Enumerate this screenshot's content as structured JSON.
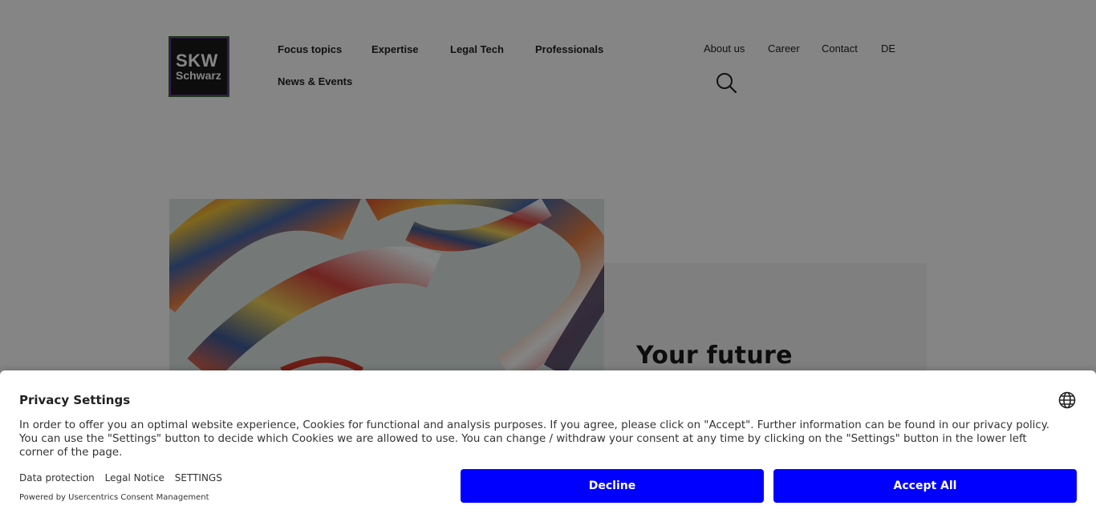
{
  "header": {
    "logo": {
      "line1": "SKW",
      "line2": "Schwarz"
    },
    "main_nav": [
      "Focus topics",
      "Expertise",
      "Legal Tech",
      "Professionals",
      "News & Events"
    ],
    "meta_nav": [
      "About us",
      "Career",
      "Contact",
      "DE"
    ],
    "search_icon": "search-icon"
  },
  "hero": {
    "title": "Your future"
  },
  "consent": {
    "title": "Privacy Settings",
    "language_icon": "globe-icon",
    "message": "In order to offer you an optimal website experience, Cookies for functional and analysis purposes. If you agree, please click on \"Accept\". Further information can be found in our privacy policy. You can use the \"Settings\" button to decide which Cookies we are allowed to use. You can change / withdraw your consent at any time by clicking on the \"Settings\" button in the lower left corner of the page.",
    "links": [
      "Data protection",
      "Legal Notice",
      "SETTINGS"
    ],
    "powered_by": "Powered by Usercentrics Consent Management",
    "decline_label": "Decline",
    "accept_label": "Accept All",
    "button_color": "#0000ff"
  }
}
